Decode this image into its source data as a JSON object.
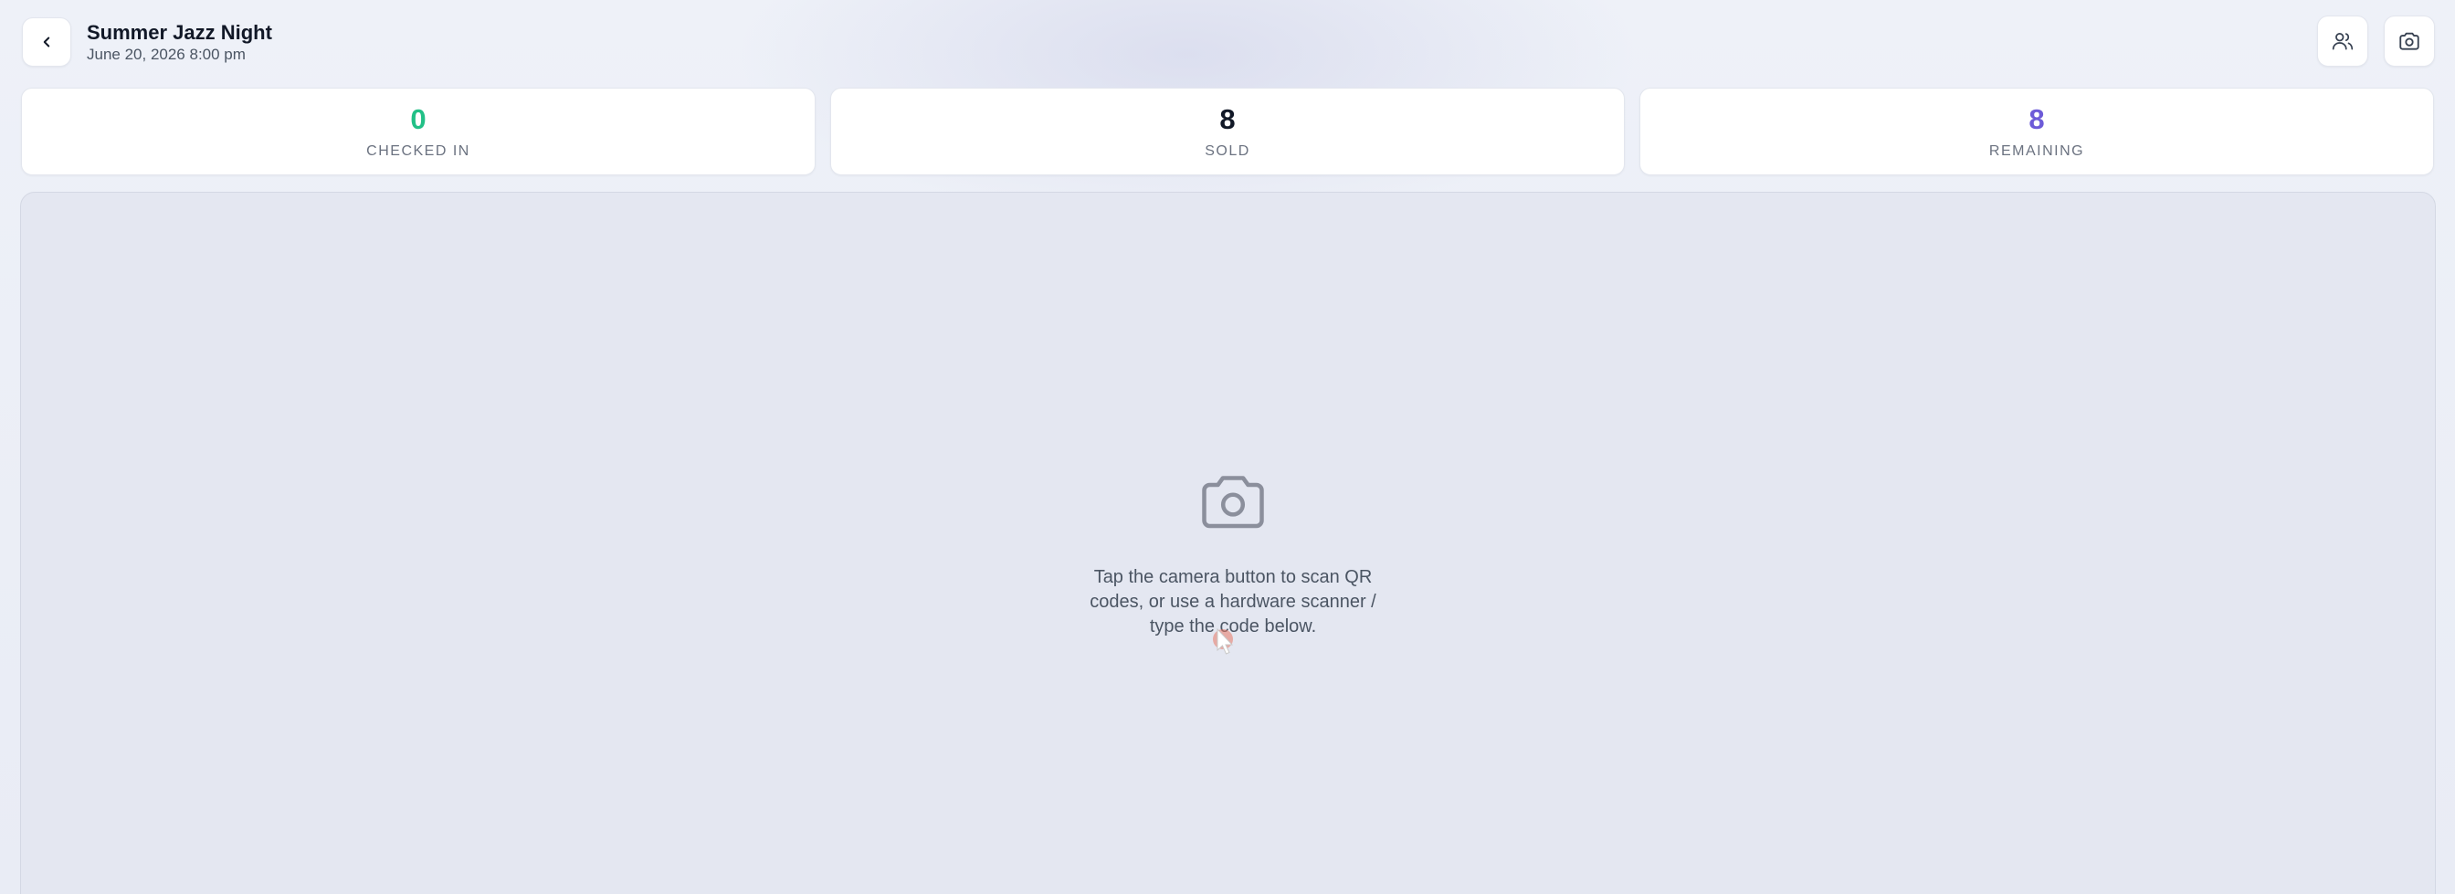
{
  "header": {
    "title": "Summer Jazz Night",
    "date": "June 20, 2026 8:00 pm",
    "back_icon": "chevron-left-icon",
    "attendees_icon": "users-icon",
    "camera_icon": "camera-icon"
  },
  "stats": [
    {
      "value": "0",
      "label": "CHECKED IN",
      "color": "#22c087"
    },
    {
      "value": "8",
      "label": "SOLD",
      "color": "#111827"
    },
    {
      "value": "8",
      "label": "REMAINING",
      "color": "#6d5bd8"
    }
  ],
  "scanner": {
    "icon": "camera-icon",
    "message": "Tap the camera button to scan QR codes, or use a hardware scanner / type the code below."
  }
}
